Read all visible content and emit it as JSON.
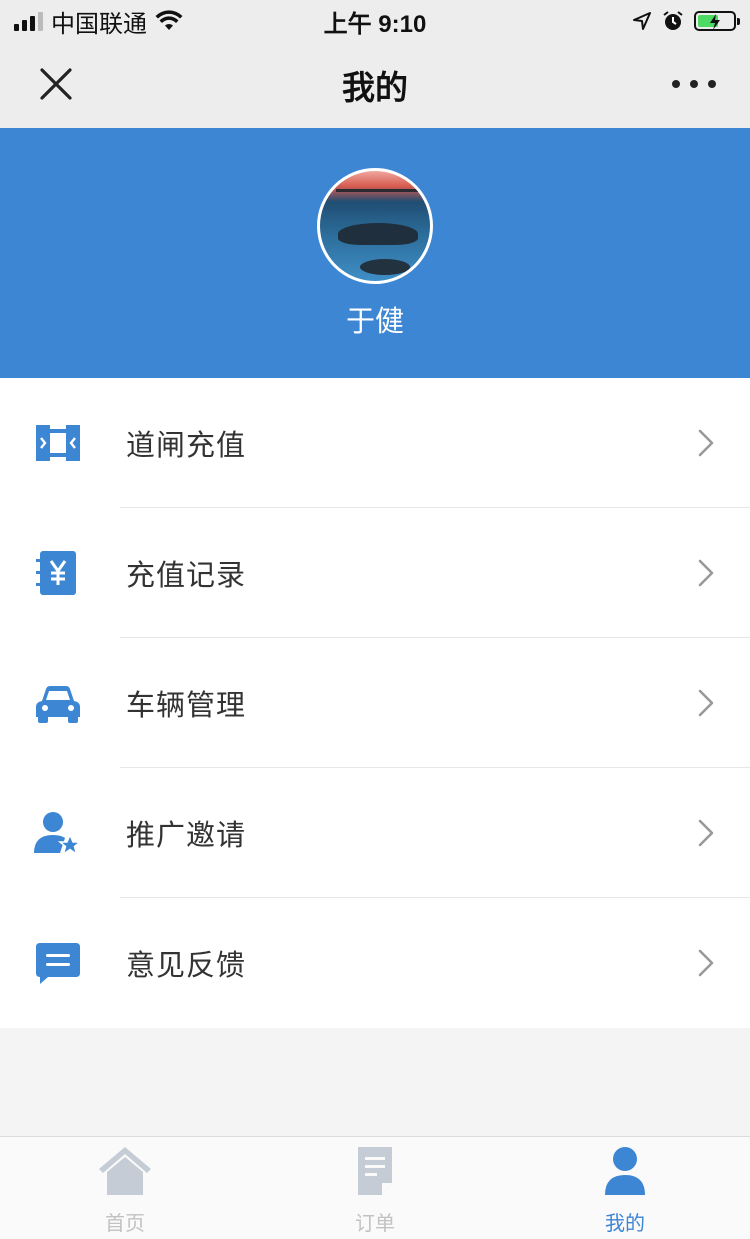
{
  "status_bar": {
    "carrier": "中国联通",
    "time": "上午 9:10",
    "battery_state": "charging"
  },
  "nav": {
    "title": "我的",
    "close_icon": "close-icon",
    "more_icon": "more-icon"
  },
  "profile": {
    "name": "于健",
    "header_color": "#3d86d4"
  },
  "menu": {
    "items": [
      {
        "label": "道闸充值",
        "icon": "gate-icon"
      },
      {
        "label": "充值记录",
        "icon": "yuan-record-icon"
      },
      {
        "label": "车辆管理",
        "icon": "car-icon"
      },
      {
        "label": "推广邀请",
        "icon": "user-star-icon"
      },
      {
        "label": "意见反馈",
        "icon": "chat-bubble-icon"
      }
    ]
  },
  "tab_bar": {
    "tabs": [
      {
        "label": "首页",
        "icon": "home-icon",
        "active": false
      },
      {
        "label": "订单",
        "icon": "order-icon",
        "active": false
      },
      {
        "label": "我的",
        "icon": "user-icon",
        "active": true
      }
    ],
    "active_color": "#3d86d4",
    "inactive_color": "#c2c2c2"
  }
}
